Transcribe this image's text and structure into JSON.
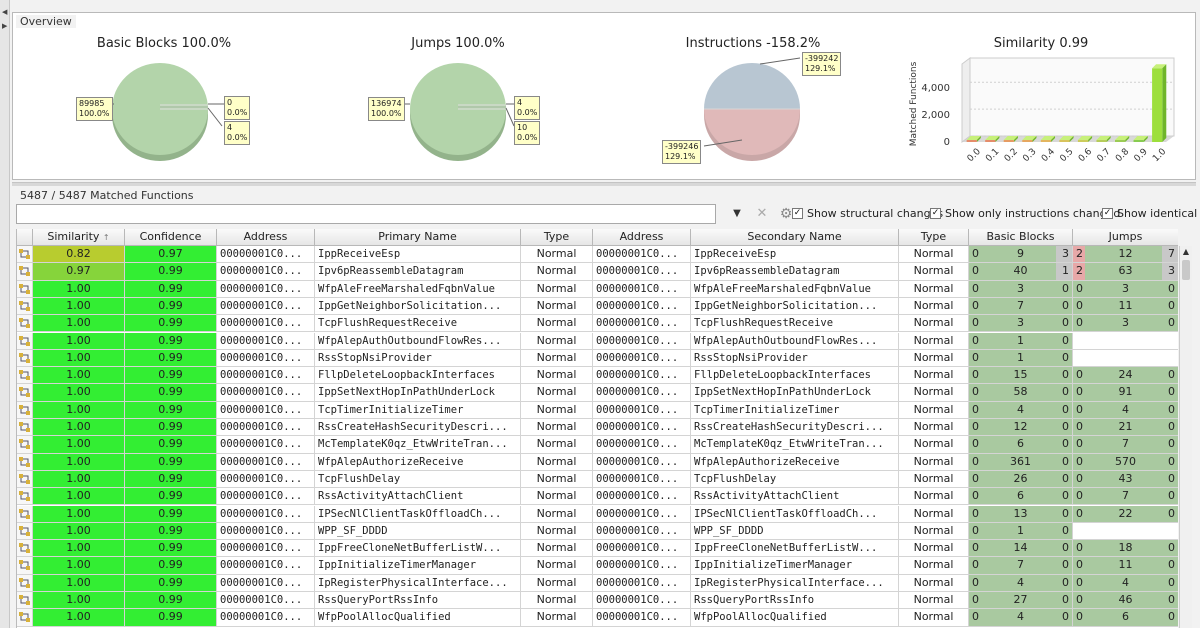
{
  "overview": {
    "label": "Overview",
    "basic_blocks": {
      "title": "Basic Blocks 100.0%",
      "callout_left": [
        "89985",
        "100.0%"
      ],
      "callout_right_1": [
        "0",
        "0.0%"
      ],
      "callout_right_2": [
        "4",
        "0.0%"
      ]
    },
    "jumps": {
      "title": "Jumps 100.0%",
      "callout_left": [
        "136974",
        "100.0%"
      ],
      "callout_right_1": [
        "4",
        "0.0%"
      ],
      "callout_right_2": [
        "10",
        "0.0%"
      ]
    },
    "instructions": {
      "title": "Instructions -158.2%",
      "callout_top": [
        "-399242",
        "129.1%"
      ],
      "callout_bottom": [
        "-399246",
        "129.1%"
      ]
    },
    "similarity": {
      "title": "Similarity 0.99"
    }
  },
  "chart_data": {
    "type": "bar",
    "title": "Similarity 0.99",
    "ylabel": "Matched Functions",
    "categories": [
      "0.0",
      "0.1",
      "0.2",
      "0.3",
      "0.4",
      "0.5",
      "0.6",
      "0.7",
      "0.8",
      "0.9",
      "1.0"
    ],
    "values": [
      0,
      0,
      0,
      0,
      0,
      0,
      0,
      0,
      0,
      0,
      5480
    ],
    "yticks": [
      "4,000",
      "2,000",
      "0"
    ],
    "ylim": [
      0,
      5800
    ]
  },
  "matched_label": "5487 / 5487 Matched Functions",
  "filters": {
    "show_structural": "Show structural changes",
    "show_instructions_changed": "Show only instructions changed",
    "show_identical": "Show identical"
  },
  "columns": {
    "similarity": "Similarity",
    "confidence": "Confidence",
    "address1": "Address",
    "primary_name": "Primary Name",
    "type1": "Type",
    "address2": "Address",
    "secondary_name": "Secondary Name",
    "type2": "Type",
    "basic_blocks": "Basic Blocks",
    "jumps": "Jumps"
  },
  "colors": {
    "sim_green": "#33ee33",
    "sim_olive": "#b8cc2f",
    "sim_olive2": "#86d43b",
    "cell_green": "#a9c9a0"
  },
  "rows": [
    {
      "sim": "0.82",
      "conf": "0.97",
      "addr1": "00000001C0...",
      "pname": "IppReceiveEsp",
      "type1": "Normal",
      "addr2": "00000001C0...",
      "sname": "IppReceiveEsp",
      "type2": "Normal",
      "bb": [
        "0",
        "9",
        "3"
      ],
      "jm": [
        "2",
        "12",
        "7"
      ]
    },
    {
      "sim": "0.97",
      "conf": "0.99",
      "addr1": "00000001C0...",
      "pname": "Ipv6pReassembleDatagram",
      "type1": "Normal",
      "addr2": "00000001C0...",
      "sname": "Ipv6pReassembleDatagram",
      "type2": "Normal",
      "bb": [
        "0",
        "40",
        "1"
      ],
      "jm": [
        "2",
        "63",
        "3"
      ]
    },
    {
      "sim": "1.00",
      "conf": "0.99",
      "addr1": "00000001C0...",
      "pname": "WfpAleFreeMarshaledFqbnValue",
      "type1": "Normal",
      "addr2": "00000001C0...",
      "sname": "WfpAleFreeMarshaledFqbnValue",
      "type2": "Normal",
      "bb": [
        "0",
        "3",
        "0"
      ],
      "jm": [
        "0",
        "3",
        "0"
      ]
    },
    {
      "sim": "1.00",
      "conf": "0.99",
      "addr1": "00000001C0...",
      "pname": "IppGetNeighborSolicitation...",
      "type1": "Normal",
      "addr2": "00000001C0...",
      "sname": "IppGetNeighborSolicitation...",
      "type2": "Normal",
      "bb": [
        "0",
        "7",
        "0"
      ],
      "jm": [
        "0",
        "11",
        "0"
      ]
    },
    {
      "sim": "1.00",
      "conf": "0.99",
      "addr1": "00000001C0...",
      "pname": "TcpFlushRequestReceive",
      "type1": "Normal",
      "addr2": "00000001C0...",
      "sname": "TcpFlushRequestReceive",
      "type2": "Normal",
      "bb": [
        "0",
        "3",
        "0"
      ],
      "jm": [
        "0",
        "3",
        "0"
      ]
    },
    {
      "sim": "1.00",
      "conf": "0.99",
      "addr1": "00000001C0...",
      "pname": "WfpAlepAuthOutboundFlowRes...",
      "type1": "Normal",
      "addr2": "00000001C0...",
      "sname": "WfpAlepAuthOutboundFlowRes...",
      "type2": "Normal",
      "bb": [
        "0",
        "1",
        "0"
      ],
      "jm": null
    },
    {
      "sim": "1.00",
      "conf": "0.99",
      "addr1": "00000001C0...",
      "pname": "RssStopNsiProvider",
      "type1": "Normal",
      "addr2": "00000001C0...",
      "sname": "RssStopNsiProvider",
      "type2": "Normal",
      "bb": [
        "0",
        "1",
        "0"
      ],
      "jm": null
    },
    {
      "sim": "1.00",
      "conf": "0.99",
      "addr1": "00000001C0...",
      "pname": "FllpDeleteLoopbackInterfaces",
      "type1": "Normal",
      "addr2": "00000001C0...",
      "sname": "FllpDeleteLoopbackInterfaces",
      "type2": "Normal",
      "bb": [
        "0",
        "15",
        "0"
      ],
      "jm": [
        "0",
        "24",
        "0"
      ]
    },
    {
      "sim": "1.00",
      "conf": "0.99",
      "addr1": "00000001C0...",
      "pname": "IppSetNextHopInPathUnderLock",
      "type1": "Normal",
      "addr2": "00000001C0...",
      "sname": "IppSetNextHopInPathUnderLock",
      "type2": "Normal",
      "bb": [
        "0",
        "58",
        "0"
      ],
      "jm": [
        "0",
        "91",
        "0"
      ]
    },
    {
      "sim": "1.00",
      "conf": "0.99",
      "addr1": "00000001C0...",
      "pname": "TcpTimerInitializeTimer",
      "type1": "Normal",
      "addr2": "00000001C0...",
      "sname": "TcpTimerInitializeTimer",
      "type2": "Normal",
      "bb": [
        "0",
        "4",
        "0"
      ],
      "jm": [
        "0",
        "4",
        "0"
      ]
    },
    {
      "sim": "1.00",
      "conf": "0.99",
      "addr1": "00000001C0...",
      "pname": "RssCreateHashSecurityDescri...",
      "type1": "Normal",
      "addr2": "00000001C0...",
      "sname": "RssCreateHashSecurityDescri...",
      "type2": "Normal",
      "bb": [
        "0",
        "12",
        "0"
      ],
      "jm": [
        "0",
        "21",
        "0"
      ]
    },
    {
      "sim": "1.00",
      "conf": "0.99",
      "addr1": "00000001C0...",
      "pname": "McTemplateK0qz_EtwWriteTran...",
      "type1": "Normal",
      "addr2": "00000001C0...",
      "sname": "McTemplateK0qz_EtwWriteTran...",
      "type2": "Normal",
      "bb": [
        "0",
        "6",
        "0"
      ],
      "jm": [
        "0",
        "7",
        "0"
      ]
    },
    {
      "sim": "1.00",
      "conf": "0.99",
      "addr1": "00000001C0...",
      "pname": "WfpAlepAuthorizeReceive",
      "type1": "Normal",
      "addr2": "00000001C0...",
      "sname": "WfpAlepAuthorizeReceive",
      "type2": "Normal",
      "bb": [
        "0",
        "361",
        "0"
      ],
      "jm": [
        "0",
        "570",
        "0"
      ]
    },
    {
      "sim": "1.00",
      "conf": "0.99",
      "addr1": "00000001C0...",
      "pname": "TcpFlushDelay",
      "type1": "Normal",
      "addr2": "00000001C0...",
      "sname": "TcpFlushDelay",
      "type2": "Normal",
      "bb": [
        "0",
        "26",
        "0"
      ],
      "jm": [
        "0",
        "43",
        "0"
      ]
    },
    {
      "sim": "1.00",
      "conf": "0.99",
      "addr1": "00000001C0...",
      "pname": "RssActivityAttachClient",
      "type1": "Normal",
      "addr2": "00000001C0...",
      "sname": "RssActivityAttachClient",
      "type2": "Normal",
      "bb": [
        "0",
        "6",
        "0"
      ],
      "jm": [
        "0",
        "7",
        "0"
      ]
    },
    {
      "sim": "1.00",
      "conf": "0.99",
      "addr1": "00000001C0...",
      "pname": "IPSecNlClientTaskOffloadCh...",
      "type1": "Normal",
      "addr2": "00000001C0...",
      "sname": "IPSecNlClientTaskOffloadCh...",
      "type2": "Normal",
      "bb": [
        "0",
        "13",
        "0"
      ],
      "jm": [
        "0",
        "22",
        "0"
      ]
    },
    {
      "sim": "1.00",
      "conf": "0.99",
      "addr1": "00000001C0...",
      "pname": "WPP_SF_DDDD",
      "type1": "Normal",
      "addr2": "00000001C0...",
      "sname": "WPP_SF_DDDD",
      "type2": "Normal",
      "bb": [
        "0",
        "1",
        "0"
      ],
      "jm": null
    },
    {
      "sim": "1.00",
      "conf": "0.99",
      "addr1": "00000001C0...",
      "pname": "IppFreeCloneNetBufferListW...",
      "type1": "Normal",
      "addr2": "00000001C0...",
      "sname": "IppFreeCloneNetBufferListW...",
      "type2": "Normal",
      "bb": [
        "0",
        "14",
        "0"
      ],
      "jm": [
        "0",
        "18",
        "0"
      ]
    },
    {
      "sim": "1.00",
      "conf": "0.99",
      "addr1": "00000001C0...",
      "pname": "IppInitializeTimerManager",
      "type1": "Normal",
      "addr2": "00000001C0...",
      "sname": "IppInitializeTimerManager",
      "type2": "Normal",
      "bb": [
        "0",
        "7",
        "0"
      ],
      "jm": [
        "0",
        "11",
        "0"
      ]
    },
    {
      "sim": "1.00",
      "conf": "0.99",
      "addr1": "00000001C0...",
      "pname": "IpRegisterPhysicalInterface...",
      "type1": "Normal",
      "addr2": "00000001C0...",
      "sname": "IpRegisterPhysicalInterface...",
      "type2": "Normal",
      "bb": [
        "0",
        "4",
        "0"
      ],
      "jm": [
        "0",
        "4",
        "0"
      ]
    },
    {
      "sim": "1.00",
      "conf": "0.99",
      "addr1": "00000001C0...",
      "pname": "RssQueryPortRssInfo",
      "type1": "Normal",
      "addr2": "00000001C0...",
      "sname": "RssQueryPortRssInfo",
      "type2": "Normal",
      "bb": [
        "0",
        "27",
        "0"
      ],
      "jm": [
        "0",
        "46",
        "0"
      ]
    },
    {
      "sim": "1.00",
      "conf": "0.99",
      "addr1": "00000001C0...",
      "pname": "WfpPoolAllocQualified",
      "type1": "Normal",
      "addr2": "00000001C0...",
      "sname": "WfpPoolAllocQualified",
      "type2": "Normal",
      "bb": [
        "0",
        "4",
        "0"
      ],
      "jm": [
        "0",
        "6",
        "0"
      ]
    }
  ]
}
